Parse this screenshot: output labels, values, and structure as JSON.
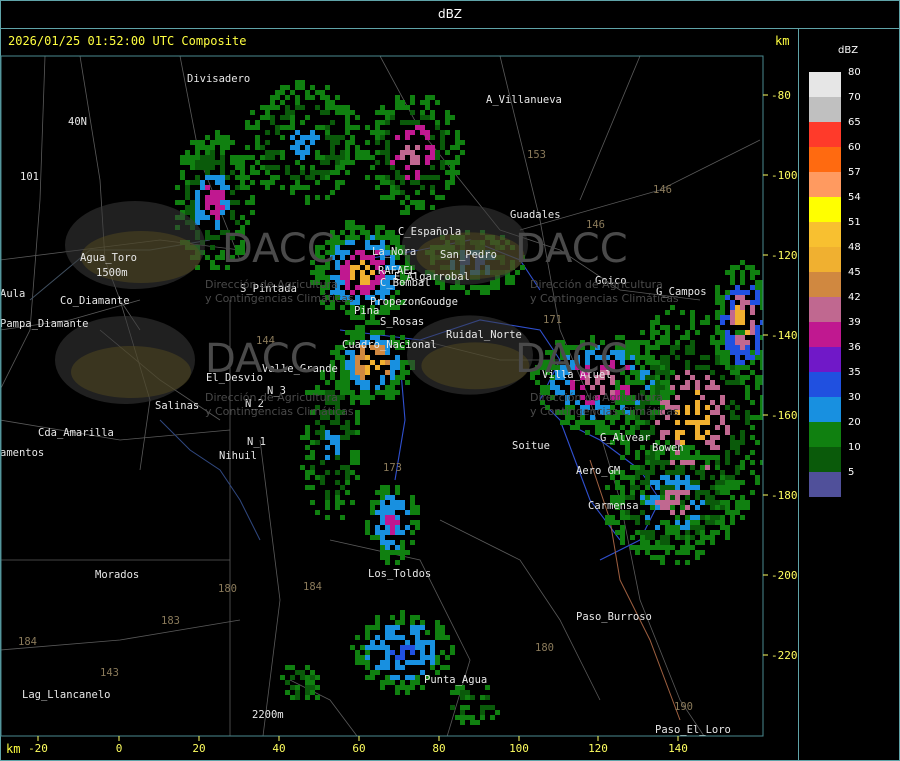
{
  "title": "dBZ",
  "timestamp": "2026/01/25 01:52:00 UTC Composite",
  "km_label": "km",
  "x_ticks": [
    "-20",
    "0",
    "20",
    "40",
    "60",
    "80",
    "100",
    "120",
    "140"
  ],
  "y_ticks": [
    "-80",
    "-100",
    "-120",
    "-140",
    "-160",
    "-180",
    "-200",
    "-220"
  ],
  "legend": {
    "title": "dBZ",
    "levels": [
      {
        "value": "80",
        "color": "#e6e6e6"
      },
      {
        "value": "70",
        "color": "#c0c0c0"
      },
      {
        "value": "65",
        "color": "#ff3a2a"
      },
      {
        "value": "60",
        "color": "#ff6a10"
      },
      {
        "value": "57",
        "color": "#ff9a60"
      },
      {
        "value": "54",
        "color": "#ffff00"
      },
      {
        "value": "51",
        "color": "#f8c030"
      },
      {
        "value": "48",
        "color": "#f0b030"
      },
      {
        "value": "45",
        "color": "#d08840"
      },
      {
        "value": "42",
        "color": "#c06890"
      },
      {
        "value": "39",
        "color": "#c01890"
      },
      {
        "value": "36",
        "color": "#7018c8"
      },
      {
        "value": "35",
        "color": "#2050e0"
      },
      {
        "value": "30",
        "color": "#1890e0"
      },
      {
        "value": "20",
        "color": "#108010"
      },
      {
        "value": "10",
        "color": "#0a5a0a"
      },
      {
        "value": "5",
        "color": "#50509a"
      }
    ]
  },
  "places": [
    "Divisadero",
    "A_Villanueva",
    "40N",
    "101",
    "Agua_Toro",
    "1500m",
    "Aula",
    "Co_Diamante",
    "Pampa_Diamante",
    "S_Pintada",
    "C_Española",
    "La_Nora",
    "RAFAEL",
    "E_Algarrobal",
    "C_Bombal",
    "Propezon",
    "Goudge",
    "Pina",
    "S_Rosas",
    "Cuadro_Nacional",
    "Ruidal_Norte",
    "Valle_Grande",
    "El_Desvio",
    "Salinas",
    "N_2",
    "N_3",
    "N_1",
    "Nihuil",
    "Cda_Amarilla",
    "amentos",
    "Guadales",
    "Villa_Atuel",
    "G_Campos",
    "Goico",
    "Soitue",
    "Aero_GM",
    "Carmensa",
    "Los_Toldos",
    "Morados",
    "Paso_Burroso",
    "Punta_Agua",
    "Lag_Llancanelo",
    "2200m",
    "Paso_El_Loro",
    "G_Alvear",
    "Bowen",
    "San_Pedro"
  ],
  "route_numbers": [
    "153",
    "146",
    "146",
    "171",
    "173",
    "180",
    "184",
    "180",
    "190",
    "143",
    "183",
    "184",
    "144"
  ],
  "watermark": {
    "name": "DACC",
    "line1": "Dirección de Agricultura",
    "line2": "y Contingencias Climáticas"
  }
}
